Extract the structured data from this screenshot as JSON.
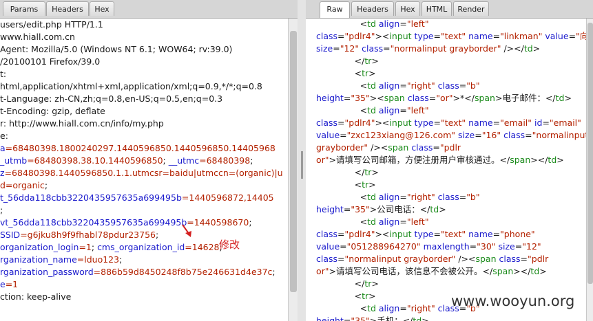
{
  "left_panel": {
    "tabs": [
      "Params",
      "Headers",
      "Hex"
    ],
    "lines": [
      [
        {
          "t": "users/edit.php HTTP/1.1",
          "c": "blk"
        }
      ],
      [
        {
          "t": "www.hiall.com.cn",
          "c": "blk"
        }
      ],
      [
        {
          "t": "Agent: Mozilla/5.0 (Windows NT 6.1; WOW64; rv:39.0)",
          "c": "blk"
        }
      ],
      [
        {
          "t": "/20100101 Firefox/39.0",
          "c": "blk"
        }
      ],
      [
        {
          "t": "t:",
          "c": "blk"
        }
      ],
      [
        {
          "t": "html,application/xhtml+xml,application/xml;q=0.9,*/*;q=0.8",
          "c": "blk"
        }
      ],
      [
        {
          "t": "t-Language: zh-CN,zh;q=0.8,en-US;q=0.5,en;q=0.3",
          "c": "blk"
        }
      ],
      [
        {
          "t": "t-Encoding: gzip, deflate",
          "c": "blk"
        }
      ],
      [
        {
          "t": "r: http://www.hiall.com.cn/info/my.php",
          "c": "blk"
        }
      ],
      [
        {
          "t": "e:",
          "c": "blk"
        }
      ],
      [
        {
          "t": "a",
          "c": "blu"
        },
        {
          "t": "=68480398.1800240297.1440596850.1440596850.14405968",
          "c": "red"
        }
      ],
      [
        {
          "t": "_utmb",
          "c": "blu"
        },
        {
          "t": "=68480398.38.10.1440596850",
          "c": "red"
        },
        {
          "t": "; ",
          "c": "blk"
        },
        {
          "t": "__utmc",
          "c": "blu"
        },
        {
          "t": "=68480398",
          "c": "red"
        },
        {
          "t": ";",
          "c": "blk"
        }
      ],
      [
        {
          "t": "z",
          "c": "blu"
        },
        {
          "t": "=68480398.1440596850.1.1.utmcsr=baidu|utmccn=(organic)|u",
          "c": "red"
        }
      ],
      [
        {
          "t": "d=organic",
          "c": "red"
        },
        {
          "t": ";",
          "c": "blk"
        }
      ],
      [
        {
          "t": "t_56dda118cbb3220435957635a699495b",
          "c": "blu"
        },
        {
          "t": "=1440596872,14405",
          "c": "red"
        }
      ],
      [
        {
          "t": ";",
          "c": "blk"
        }
      ],
      [
        {
          "t": "vt_56dda118cbb3220435957635a699495b",
          "c": "blu"
        },
        {
          "t": "=1440598670",
          "c": "red"
        },
        {
          "t": ";",
          "c": "blk"
        }
      ],
      [
        {
          "t": "SSID",
          "c": "blu"
        },
        {
          "t": "=g6jku8h9f9fhabl78pdur23756",
          "c": "red"
        },
        {
          "t": ";",
          "c": "blk"
        }
      ],
      [
        {
          "t": "organization_login",
          "c": "blu"
        },
        {
          "t": "=1",
          "c": "red"
        },
        {
          "t": "; ",
          "c": "blk"
        },
        {
          "t": "cms_organization_id",
          "c": "blu"
        },
        {
          "t": "=14628",
          "c": "red"
        },
        {
          "t": ";",
          "c": "blk"
        }
      ],
      [
        {
          "t": "rganization_name",
          "c": "blu"
        },
        {
          "t": "=lduo123",
          "c": "red"
        },
        {
          "t": ";",
          "c": "blk"
        }
      ],
      [
        {
          "t": "rganization_password",
          "c": "blu"
        },
        {
          "t": "=886b59d8450248f8b75e246631d4e37c",
          "c": "red"
        },
        {
          "t": ";",
          "c": "blk"
        }
      ],
      [
        {
          "t": "e",
          "c": "blu"
        },
        {
          "t": "=1",
          "c": "red"
        }
      ],
      [
        {
          "t": "ction: keep-alive",
          "c": "blk"
        }
      ]
    ]
  },
  "annotation": "修改",
  "right_panel": {
    "tabs": [
      "Raw",
      "Headers",
      "Hex",
      "HTML",
      "Render"
    ],
    "lines": [
      [
        {
          "t": "                <",
          "c": "blk"
        },
        {
          "t": "td ",
          "c": "grn"
        },
        {
          "t": "align",
          "c": "blu"
        },
        {
          "t": "=",
          "c": "blk"
        },
        {
          "t": "\"left\"",
          "c": "red"
        }
      ],
      [
        {
          "t": "class",
          "c": "blu"
        },
        {
          "t": "=",
          "c": "blk"
        },
        {
          "t": "\"pdlr4\"",
          "c": "red"
        },
        {
          "t": "><",
          "c": "blk"
        },
        {
          "t": "input ",
          "c": "grn"
        },
        {
          "t": "type",
          "c": "blu"
        },
        {
          "t": "=",
          "c": "blk"
        },
        {
          "t": "\"text\" ",
          "c": "red"
        },
        {
          "t": "name",
          "c": "blu"
        },
        {
          "t": "=",
          "c": "blk"
        },
        {
          "t": "\"linkman\" ",
          "c": "red"
        },
        {
          "t": "value",
          "c": "blu"
        },
        {
          "t": "=",
          "c": "blk"
        },
        {
          "t": "\"向主",
          "c": "red"
        }
      ],
      [
        {
          "t": "size",
          "c": "blu"
        },
        {
          "t": "=",
          "c": "blk"
        },
        {
          "t": "\"12\" ",
          "c": "red"
        },
        {
          "t": "class",
          "c": "blu"
        },
        {
          "t": "=",
          "c": "blk"
        },
        {
          "t": "\"normalinput grayborder\" ",
          "c": "red"
        },
        {
          "t": "/></",
          "c": "blk"
        },
        {
          "t": "td",
          "c": "grn"
        },
        {
          "t": ">",
          "c": "blk"
        }
      ],
      [
        {
          "t": "              </",
          "c": "blk"
        },
        {
          "t": "tr",
          "c": "grn"
        },
        {
          "t": ">",
          "c": "blk"
        }
      ],
      [
        {
          "t": "              <",
          "c": "blk"
        },
        {
          "t": "tr",
          "c": "grn"
        },
        {
          "t": ">",
          "c": "blk"
        }
      ],
      [
        {
          "t": "                <",
          "c": "blk"
        },
        {
          "t": "td ",
          "c": "grn"
        },
        {
          "t": "align",
          "c": "blu"
        },
        {
          "t": "=",
          "c": "blk"
        },
        {
          "t": "\"right\" ",
          "c": "red"
        },
        {
          "t": "class",
          "c": "blu"
        },
        {
          "t": "=",
          "c": "blk"
        },
        {
          "t": "\"b\"",
          "c": "red"
        }
      ],
      [
        {
          "t": "height",
          "c": "blu"
        },
        {
          "t": "=",
          "c": "blk"
        },
        {
          "t": "\"35\"",
          "c": "red"
        },
        {
          "t": "><",
          "c": "blk"
        },
        {
          "t": "span ",
          "c": "grn"
        },
        {
          "t": "class",
          "c": "blu"
        },
        {
          "t": "=",
          "c": "blk"
        },
        {
          "t": "\"or\"",
          "c": "red"
        },
        {
          "t": ">*</",
          "c": "blk"
        },
        {
          "t": "span",
          "c": "grn"
        },
        {
          "t": ">电子邮件：</",
          "c": "blk"
        },
        {
          "t": "td",
          "c": "grn"
        },
        {
          "t": ">",
          "c": "blk"
        }
      ],
      [
        {
          "t": "                <",
          "c": "blk"
        },
        {
          "t": "td ",
          "c": "grn"
        },
        {
          "t": "align",
          "c": "blu"
        },
        {
          "t": "=",
          "c": "blk"
        },
        {
          "t": "\"left\"",
          "c": "red"
        }
      ],
      [
        {
          "t": "class",
          "c": "blu"
        },
        {
          "t": "=",
          "c": "blk"
        },
        {
          "t": "\"pdlr4\"",
          "c": "red"
        },
        {
          "t": "><",
          "c": "blk"
        },
        {
          "t": "input ",
          "c": "grn"
        },
        {
          "t": "type",
          "c": "blu"
        },
        {
          "t": "=",
          "c": "blk"
        },
        {
          "t": "\"text\" ",
          "c": "red"
        },
        {
          "t": "name",
          "c": "blu"
        },
        {
          "t": "=",
          "c": "blk"
        },
        {
          "t": "\"email\" ",
          "c": "red"
        },
        {
          "t": "id",
          "c": "blu"
        },
        {
          "t": "=",
          "c": "blk"
        },
        {
          "t": "\"email\"",
          "c": "red"
        }
      ],
      [
        {
          "t": "value",
          "c": "blu"
        },
        {
          "t": "=",
          "c": "blk"
        },
        {
          "t": "\"zxc123xiang@126.com\" ",
          "c": "red"
        },
        {
          "t": "size",
          "c": "blu"
        },
        {
          "t": "=",
          "c": "blk"
        },
        {
          "t": "\"16\" ",
          "c": "red"
        },
        {
          "t": "class",
          "c": "blu"
        },
        {
          "t": "=",
          "c": "blk"
        },
        {
          "t": "\"normalinput",
          "c": "red"
        }
      ],
      [
        {
          "t": "grayborder\" ",
          "c": "red"
        },
        {
          "t": "/><",
          "c": "blk"
        },
        {
          "t": "span ",
          "c": "grn"
        },
        {
          "t": "class",
          "c": "blu"
        },
        {
          "t": "=",
          "c": "blk"
        },
        {
          "t": "\"pdlr",
          "c": "red"
        }
      ],
      [
        {
          "t": "or\"",
          "c": "red"
        },
        {
          "t": ">请填写公司邮箱，方便注册用户审核通过。</",
          "c": "blk"
        },
        {
          "t": "span",
          "c": "grn"
        },
        {
          "t": "></",
          "c": "blk"
        },
        {
          "t": "td",
          "c": "grn"
        },
        {
          "t": ">",
          "c": "blk"
        }
      ],
      [
        {
          "t": "              </",
          "c": "blk"
        },
        {
          "t": "tr",
          "c": "grn"
        },
        {
          "t": ">",
          "c": "blk"
        }
      ],
      [
        {
          "t": "              <",
          "c": "blk"
        },
        {
          "t": "tr",
          "c": "grn"
        },
        {
          "t": ">",
          "c": "blk"
        }
      ],
      [
        {
          "t": "                <",
          "c": "blk"
        },
        {
          "t": "td ",
          "c": "grn"
        },
        {
          "t": "align",
          "c": "blu"
        },
        {
          "t": "=",
          "c": "blk"
        },
        {
          "t": "\"right\" ",
          "c": "red"
        },
        {
          "t": "class",
          "c": "blu"
        },
        {
          "t": "=",
          "c": "blk"
        },
        {
          "t": "\"b\"",
          "c": "red"
        }
      ],
      [
        {
          "t": "height",
          "c": "blu"
        },
        {
          "t": "=",
          "c": "blk"
        },
        {
          "t": "\"35\"",
          "c": "red"
        },
        {
          "t": ">公司电话：</",
          "c": "blk"
        },
        {
          "t": "td",
          "c": "grn"
        },
        {
          "t": ">",
          "c": "blk"
        }
      ],
      [
        {
          "t": "                <",
          "c": "blk"
        },
        {
          "t": "td ",
          "c": "grn"
        },
        {
          "t": "align",
          "c": "blu"
        },
        {
          "t": "=",
          "c": "blk"
        },
        {
          "t": "\"left\"",
          "c": "red"
        }
      ],
      [
        {
          "t": "class",
          "c": "blu"
        },
        {
          "t": "=",
          "c": "blk"
        },
        {
          "t": "\"pdlr4\"",
          "c": "red"
        },
        {
          "t": "><",
          "c": "blk"
        },
        {
          "t": "input ",
          "c": "grn"
        },
        {
          "t": "type",
          "c": "blu"
        },
        {
          "t": "=",
          "c": "blk"
        },
        {
          "t": "\"text\" ",
          "c": "red"
        },
        {
          "t": "name",
          "c": "blu"
        },
        {
          "t": "=",
          "c": "blk"
        },
        {
          "t": "\"phone\"",
          "c": "red"
        }
      ],
      [
        {
          "t": "value",
          "c": "blu"
        },
        {
          "t": "=",
          "c": "blk"
        },
        {
          "t": "\"051288964270\" ",
          "c": "red"
        },
        {
          "t": "maxlength",
          "c": "blu"
        },
        {
          "t": "=",
          "c": "blk"
        },
        {
          "t": "\"30\" ",
          "c": "red"
        },
        {
          "t": "size",
          "c": "blu"
        },
        {
          "t": "=",
          "c": "blk"
        },
        {
          "t": "\"12\"",
          "c": "red"
        }
      ],
      [
        {
          "t": "class",
          "c": "blu"
        },
        {
          "t": "=",
          "c": "blk"
        },
        {
          "t": "\"normalinput grayborder\" ",
          "c": "red"
        },
        {
          "t": "/><",
          "c": "blk"
        },
        {
          "t": "span ",
          "c": "grn"
        },
        {
          "t": "class",
          "c": "blu"
        },
        {
          "t": "=",
          "c": "blk"
        },
        {
          "t": "\"pdlr",
          "c": "red"
        }
      ],
      [
        {
          "t": "or\"",
          "c": "red"
        },
        {
          "t": ">请填写公司电话，该信息不会被公开。</",
          "c": "blk"
        },
        {
          "t": "span",
          "c": "grn"
        },
        {
          "t": "></",
          "c": "blk"
        },
        {
          "t": "td",
          "c": "grn"
        },
        {
          "t": ">",
          "c": "blk"
        }
      ],
      [
        {
          "t": "              </",
          "c": "blk"
        },
        {
          "t": "tr",
          "c": "grn"
        },
        {
          "t": ">",
          "c": "blk"
        }
      ],
      [
        {
          "t": "              <",
          "c": "blk"
        },
        {
          "t": "tr",
          "c": "grn"
        },
        {
          "t": ">",
          "c": "blk"
        }
      ],
      [
        {
          "t": "                <",
          "c": "blk"
        },
        {
          "t": "td ",
          "c": "grn"
        },
        {
          "t": "align",
          "c": "blu"
        },
        {
          "t": "=",
          "c": "blk"
        },
        {
          "t": "\"right\" ",
          "c": "red"
        },
        {
          "t": "class",
          "c": "blu"
        },
        {
          "t": "=",
          "c": "blk"
        },
        {
          "t": "\"b\"",
          "c": "red"
        }
      ],
      [
        {
          "t": "height",
          "c": "blu"
        },
        {
          "t": "=",
          "c": "blk"
        },
        {
          "t": "\"35\"",
          "c": "red"
        },
        {
          "t": ">手机：</",
          "c": "blk"
        },
        {
          "t": "td",
          "c": "grn"
        },
        {
          "t": ">",
          "c": "blk"
        }
      ]
    ]
  },
  "watermark": "www.wooyun.org",
  "colors": {
    "markup_tag": "#1a8a1a",
    "attribute": "#1a1acc",
    "value": "#b32100",
    "text": "#1a1a1a",
    "annotation": "#d42020"
  }
}
